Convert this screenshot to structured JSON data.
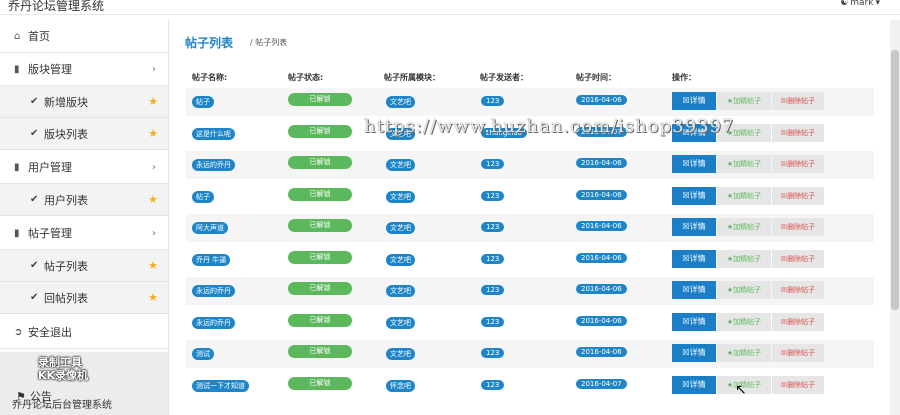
{
  "app": {
    "title": "乔丹论坛管理系统",
    "user": "mark"
  },
  "sidebar": {
    "home": "首页",
    "board_mgmt": "版块管理",
    "board_add": "新增版块",
    "board_list": "版块列表",
    "user_mgmt": "用户管理",
    "user_list": "用户列表",
    "post_mgmt": "帖子管理",
    "post_list": "帖子列表",
    "reply_list": "回帖列表",
    "logout": "安全退出",
    "notice": "公告",
    "footer": "乔丹论坛后台管理系统",
    "recorder_line1": "录制工具",
    "recorder_line2": "KK录像机"
  },
  "main": {
    "title": "帖子列表",
    "breadcrumb": "/ 帖子列表",
    "watermark": "https://www.huzhan.com/ishop39397",
    "columns": [
      "帖子名称:",
      "帖子状态:",
      "帖子所属模块：",
      "帖子发送者：",
      "帖子时间：",
      "操作："
    ],
    "rows": [
      {
        "title": "帖子",
        "status": "已解锁",
        "module": "文艺吧",
        "author": "123",
        "time": "2016-04-06"
      },
      {
        "title": "这是什么呢",
        "status": "已解锁",
        "module": "文艺吧",
        "author": "zhangxiao",
        "time": "2016-04-07"
      },
      {
        "title": "永远的乔丹",
        "status": "已解锁",
        "module": "文艺吧",
        "author": "123",
        "time": "2016-04-06"
      },
      {
        "title": "帖子",
        "status": "已解锁",
        "module": "文艺吧",
        "author": "123",
        "time": "2016-04-06"
      },
      {
        "title": "阿大声道",
        "status": "已解锁",
        "module": "文艺吧",
        "author": "123",
        "time": "2016-04-06"
      },
      {
        "title": "乔丹 牛逼",
        "status": "已解锁",
        "module": "文艺吧",
        "author": "123",
        "time": "2016-04-06"
      },
      {
        "title": "永远的乔丹",
        "status": "已解锁",
        "module": "文艺吧",
        "author": "123",
        "time": "2016-04-06"
      },
      {
        "title": "永远的乔丹",
        "status": "已解锁",
        "module": "文艺吧",
        "author": "123",
        "time": "2016-04-06"
      },
      {
        "title": "测试",
        "status": "已解锁",
        "module": "文艺吧",
        "author": "123",
        "time": "2016-04-06"
      },
      {
        "title": "测试一下才知道",
        "status": "已解锁",
        "module": "怀念吧",
        "author": "123",
        "time": "2016-04-07"
      }
    ],
    "actions": {
      "detail": "详情",
      "pin": "加精帖子",
      "delete": "删除帖子"
    }
  }
}
